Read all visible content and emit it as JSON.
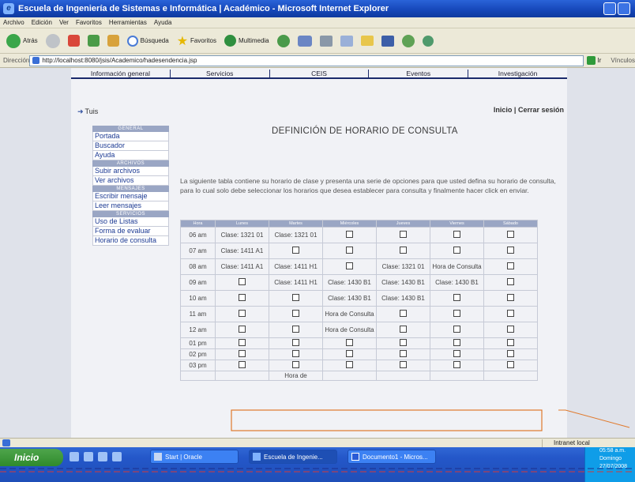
{
  "window": {
    "title": "Escuela de Ingeniería de Sistemas e Informática | Académico - Microsoft Internet Explorer"
  },
  "menu": [
    "Archivo",
    "Edición",
    "Ver",
    "Favoritos",
    "Herramientas",
    "Ayuda"
  ],
  "toolbar": {
    "back": "Atrás",
    "search": "Búsqueda",
    "favorites": "Favoritos",
    "multimedia": "Multimedia"
  },
  "address": {
    "label": "Dirección",
    "url": "http://localhost:8080/jsis/Academico/hadesendencia.jsp",
    "go": "Ir",
    "links": "Vínculos"
  },
  "nav": [
    "Información general",
    "Servicios",
    "CEIS",
    "Eventos",
    "Investigación"
  ],
  "user": {
    "name": "Tuis"
  },
  "toplinks": {
    "home": "Inicio",
    "separator": "|",
    "logout": "Cerrar sesión"
  },
  "sidebar": {
    "head1": "GENERAL",
    "items1": [
      "Portada",
      "Buscador",
      "Ayuda"
    ],
    "head2": "ARCHIVOS",
    "items2": [
      "Subir archivos",
      "Ver archivos"
    ],
    "head3": "MENSAJES",
    "items3": [
      "Escribir mensaje",
      "Leer mensajes"
    ],
    "head4": "SERVICIOS",
    "items4": [
      "Uso de Listas",
      "Forma de evaluar",
      "Horario de consulta"
    ]
  },
  "page": {
    "title": "DEFINICIÓN DE HORARIO DE CONSULTA",
    "intro": "La siguiente tabla contiene su horario de clase y presenta una serie de opciones para que usted defina su horario de consulta, para lo cual solo debe seleccionar los horarios que desea establecer para consulta y finalmente hacer click en enviar."
  },
  "schedule": {
    "headers": [
      "Hora",
      "Lunes",
      "Martes",
      "Miércoles",
      "Jueves",
      "Viernes",
      "Sábado"
    ],
    "rows": [
      {
        "hour": "06 am",
        "cells": [
          "Clase: 1321 01",
          "Clase: 1321 01",
          "",
          "",
          "",
          ""
        ]
      },
      {
        "hour": "07 am",
        "cells": [
          "Clase: 1411 A1",
          "",
          "",
          "",
          "",
          ""
        ]
      },
      {
        "hour": "08 am",
        "cells": [
          "Clase: 1411 A1",
          "Clase: 1411 H1",
          "",
          "Clase: 1321 01",
          "Hora de Consulta",
          ""
        ]
      },
      {
        "hour": "09 am",
        "cells": [
          "",
          "Clase: 1411 H1",
          "Clase: 1430 B1",
          "Clase: 1430 B1",
          "Clase: 1430 B1",
          ""
        ]
      },
      {
        "hour": "10 am",
        "cells": [
          "",
          "",
          "Clase: 1430 B1",
          "Clase: 1430 B1",
          "",
          ""
        ]
      },
      {
        "hour": "11 am",
        "cells": [
          "",
          "",
          "Hora de Consulta",
          "",
          "",
          ""
        ]
      },
      {
        "hour": "12 am",
        "cells": [
          "",
          "",
          "Hora de Consulta",
          "",
          "",
          ""
        ]
      },
      {
        "hour": "01 pm",
        "cells": [
          "",
          "",
          "",
          "",
          "",
          ""
        ]
      },
      {
        "hour": "02 pm",
        "cells": [
          "",
          "",
          "",
          "",
          "",
          ""
        ]
      },
      {
        "hour": "03 pm",
        "cells": [
          "",
          "",
          "",
          "",
          "",
          ""
        ]
      },
      {
        "hour": "",
        "cells": [
          "",
          "Hora de",
          "",
          "",
          "",
          ""
        ]
      }
    ]
  },
  "status": {
    "zone": "Intranet local"
  },
  "taskbar": {
    "start": "Inicio",
    "buttons": [
      "Start | Oracle",
      "Escuela de Ingenie...",
      "Documento1 - Micros..."
    ],
    "clock": "05:58 a.m.",
    "day": "Domingo",
    "date": "27/07/2008"
  }
}
